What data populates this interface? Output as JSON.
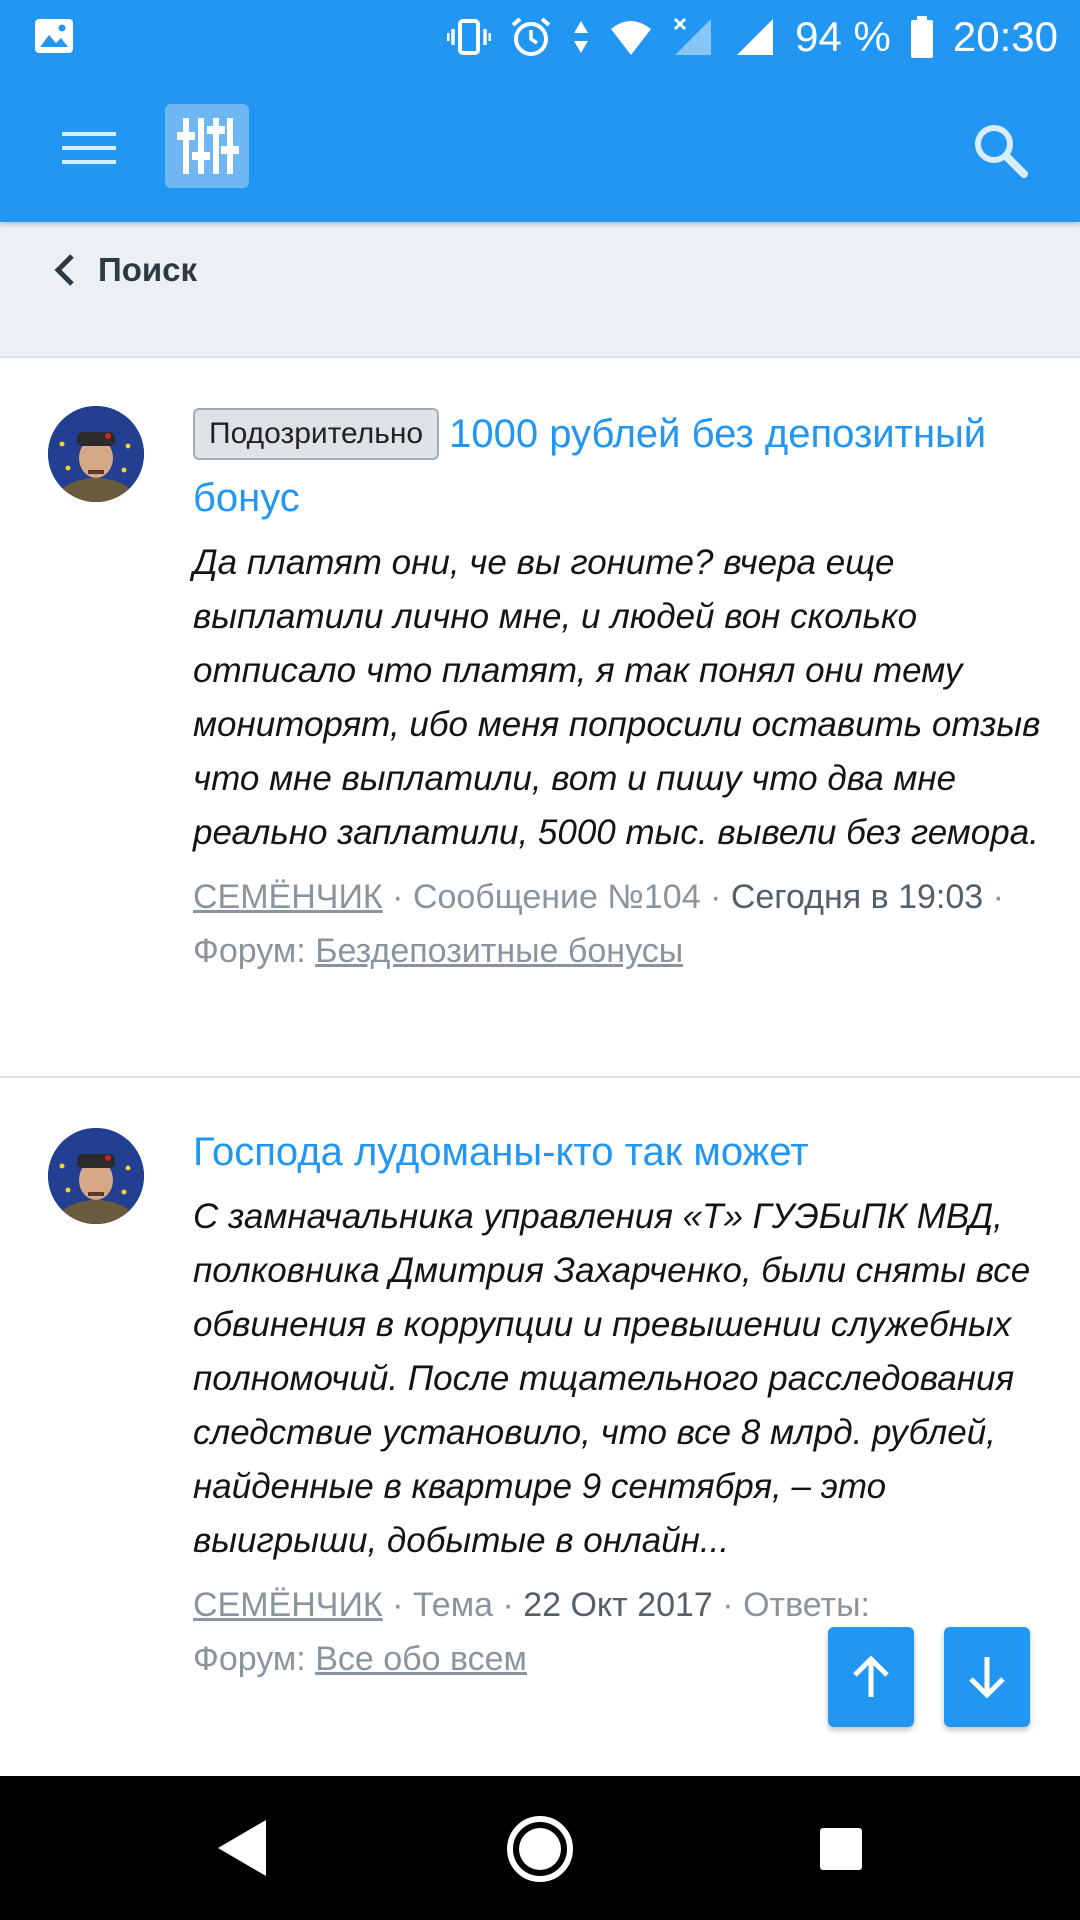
{
  "status_bar": {
    "battery_percent": "94 %",
    "time": "20:30",
    "icons": [
      "image-notification-icon",
      "vibrate-icon",
      "alarm-icon",
      "data-arrows-icon",
      "wifi-icon",
      "no-signal-icon",
      "signal-icon",
      "battery-icon"
    ]
  },
  "app_bar": {
    "icons": [
      "menu-icon",
      "forum-logo-icon",
      "search-icon"
    ]
  },
  "breadcrumb": {
    "back_label": "Поиск"
  },
  "results": [
    {
      "badge": "Подозрительно",
      "title": "1000 рублей без депозитный бонус",
      "snippet": "Да платят они, че вы гоните? вчера еще выплатили лично мне, и людей вон сколько отписало что платят, я так понял они тему мониторят, ибо меня попросили оставить отзыв что мне выплатили, вот и пишу что два мне реально заплатили, 5000 тыс. вывели без гемора.",
      "author": "СЕМЁНЧИК",
      "type": "Сообщение №104",
      "date": "Сегодня в 19:03",
      "forum_label": "Форум:",
      "forum": "Бездепозитные бонусы",
      "sep": " · "
    },
    {
      "title": "Господа лудоманы-кто так может",
      "snippet": "С замначальника управления «Т» ГУЭБиПК МВД, полковника Дмитрия Захарченко, были сняты все обвинения в коррупции и превышении служебных полномочий. После тщательного расследования следствие установило, что все 8 млрд. рублей, найденные в квартире 9 сентября, – это выигрыши, добытые в онлайн...",
      "author": "СЕМЁНЧИК",
      "type": "Тема",
      "date": "22 Окт 2017",
      "replies_partial": "Ответы:",
      "forum_label": "Форум:",
      "forum": "Все обо всем",
      "sep": " · "
    }
  ],
  "fab": {
    "up_icon": "arrow-up-icon",
    "down_icon": "arrow-down-icon"
  },
  "nav_bar": {
    "icons": [
      "back-triangle-icon",
      "home-circle-icon",
      "recents-square-icon"
    ]
  },
  "colors": {
    "primary": "#2196f3",
    "link": "#2196f3",
    "crumb_bg": "#edf0f3",
    "meta_text": "#8a949c"
  }
}
